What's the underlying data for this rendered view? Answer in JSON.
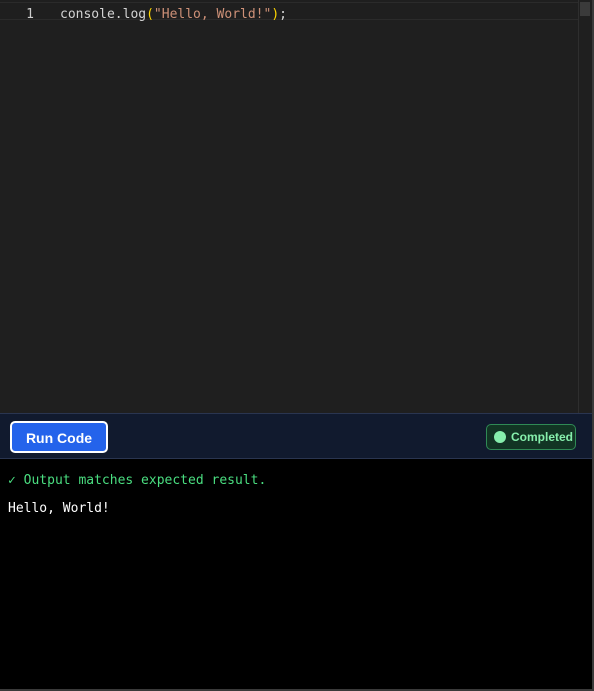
{
  "editor": {
    "lines": [
      {
        "number": "1",
        "tokens": {
          "call": "console.log",
          "open_paren": "(",
          "string": "\"Hello, World!\"",
          "close_paren": ")",
          "semicolon": ";"
        }
      }
    ],
    "colors": {
      "background": "#1f1f1f",
      "plain": "#d4d4d4",
      "paren": "#ffd700",
      "string": "#ce9178"
    }
  },
  "toolbar": {
    "run_label": "Run Code",
    "status_label": "Completed",
    "colors": {
      "run_button": "#2463eb",
      "status": "#86efac"
    }
  },
  "output": {
    "result_message": "✓ Output matches expected result.",
    "stdout": "Hello, World!",
    "colors": {
      "result": "#4ade80",
      "stdout": "#ffffff"
    }
  }
}
